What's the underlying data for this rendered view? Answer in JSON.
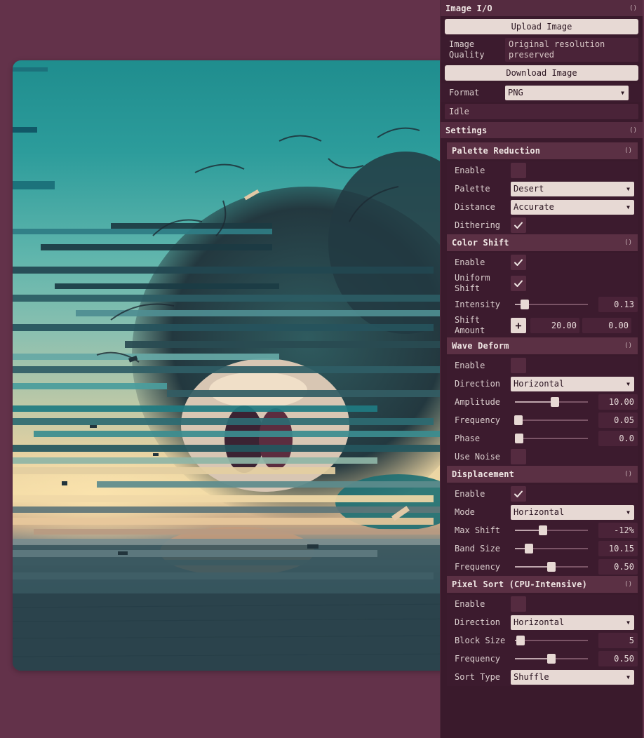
{
  "image_io": {
    "title": "Image I/O",
    "upload_label": "Upload Image",
    "quality_label": "Image Quality",
    "quality_value": "Original resolution preserved",
    "download_label": "Download Image",
    "format_label": "Format",
    "format_value": "PNG",
    "status": "Idle"
  },
  "settings": {
    "title": "Settings"
  },
  "palette": {
    "title": "Palette Reduction",
    "enable_label": "Enable",
    "enable": false,
    "palette_label": "Palette",
    "palette_value": "Desert",
    "distance_label": "Distance",
    "distance_value": "Accurate",
    "dithering_label": "Dithering",
    "dithering": true
  },
  "color_shift": {
    "title": "Color Shift",
    "enable_label": "Enable",
    "enable": true,
    "uniform_label": "Uniform Shift",
    "uniform": true,
    "intensity_label": "Intensity",
    "intensity_value": "0.13",
    "intensity_fraction": 0.13,
    "shift_label": "Shift Amount",
    "shift_x": "20.00",
    "shift_y": "0.00"
  },
  "wave": {
    "title": "Wave Deform",
    "enable_label": "Enable",
    "enable": false,
    "direction_label": "Direction",
    "direction_value": "Horizontal",
    "amplitude_label": "Amplitude",
    "amplitude_value": "10.00",
    "amplitude_fraction": 0.55,
    "frequency_label": "Frequency",
    "frequency_value": "0.05",
    "frequency_fraction": 0.05,
    "phase_label": "Phase",
    "phase_value": "0.0",
    "phase_fraction": 0.0,
    "noise_label": "Use Noise",
    "noise": false
  },
  "displacement": {
    "title": "Displacement",
    "enable_label": "Enable",
    "enable": true,
    "mode_label": "Mode",
    "mode_value": "Horizontal",
    "max_shift_label": "Max Shift",
    "max_shift_value": "-12%",
    "max_shift_fraction": 0.38,
    "band_label": "Band Size",
    "band_value": "10.15",
    "band_fraction": 0.19,
    "frequency_label": "Frequency",
    "frequency_value": "0.50",
    "frequency_fraction": 0.5
  },
  "pixel_sort": {
    "title": "Pixel Sort (CPU-Intensive)",
    "enable_label": "Enable",
    "enable": false,
    "direction_label": "Direction",
    "direction_value": "Horizontal",
    "block_label": "Block Size",
    "block_value": "5",
    "block_fraction": 0.08,
    "frequency_label": "Frequency",
    "frequency_value": "0.50",
    "frequency_fraction": 0.5,
    "sort_type_label": "Sort Type",
    "sort_type_value": "Shuffle"
  }
}
